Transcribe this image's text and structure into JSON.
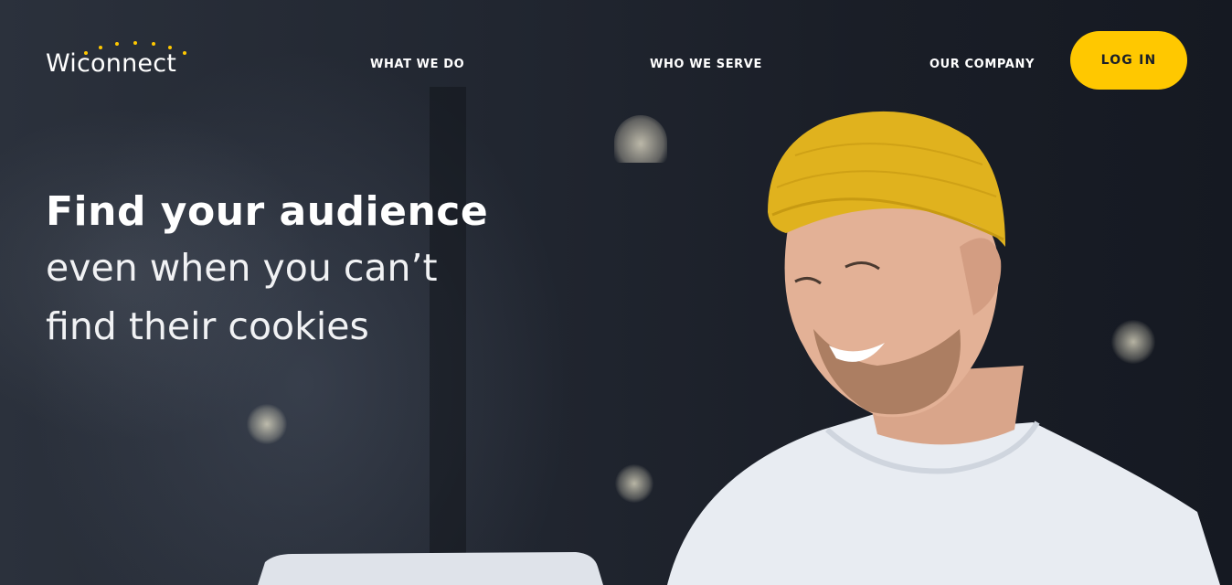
{
  "brand": {
    "logo_text": "Wiconnect",
    "accent_color": "#ffc800"
  },
  "nav": {
    "items": [
      {
        "label": "WHAT WE DO"
      },
      {
        "label": "WHO WE SERVE"
      },
      {
        "label": "OUR COMPANY"
      }
    ],
    "login_label": "LOG IN"
  },
  "hero": {
    "headline_bold": "Find your audience",
    "headline_line2": "even when you can’t",
    "headline_line3": "find their cookies",
    "image_subject": "smiling man in yellow beanie using laptop"
  }
}
